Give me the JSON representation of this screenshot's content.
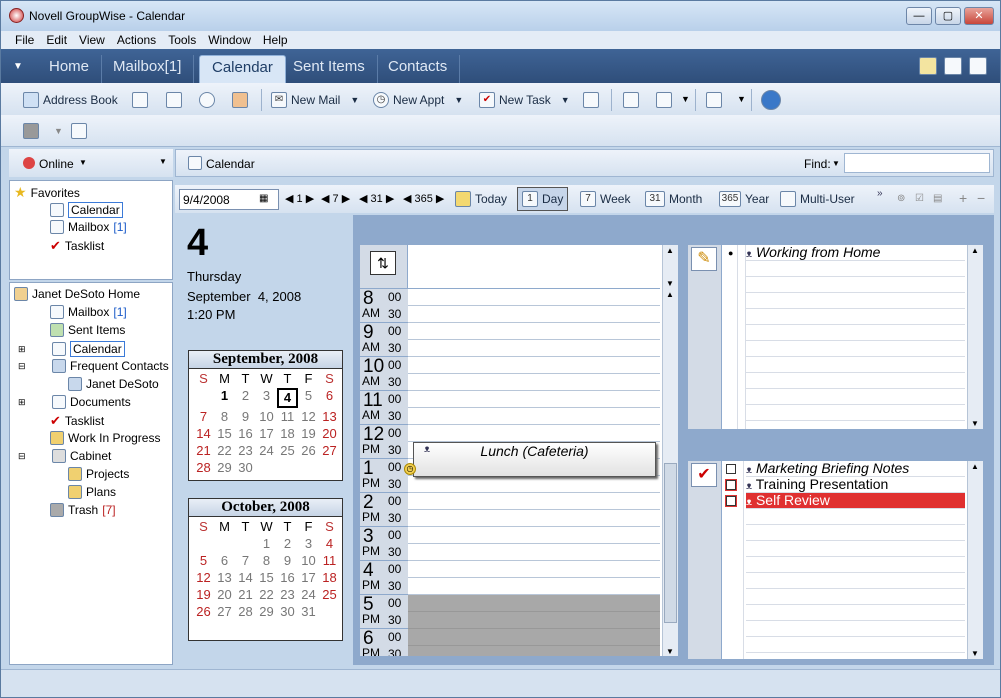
{
  "window": {
    "title": "Novell GroupWise - Calendar",
    "min": "—",
    "max": "▢",
    "close": "✕"
  },
  "menu": [
    "File",
    "Edit",
    "View",
    "Actions",
    "Tools",
    "Window",
    "Help"
  ],
  "tabs": [
    "Home",
    "Mailbox[1]",
    "Calendar",
    "Sent Items",
    "Contacts"
  ],
  "toolbar": {
    "address_book": "Address Book",
    "new_mail": "New Mail",
    "new_appt": "New Appt",
    "new_task": "New Task"
  },
  "left": {
    "online": "Online",
    "favorites": {
      "label": "Favorites",
      "calendar": "Calendar",
      "mailbox": "Mailbox",
      "mailbox_count": "[1]",
      "tasklist": "Tasklist"
    },
    "home": {
      "label": "Janet DeSoto Home",
      "mailbox": "Mailbox",
      "mailbox_count": "[1]",
      "sent": "Sent Items",
      "calendar": "Calendar",
      "frequent": "Frequent Contacts",
      "janet": "Janet DeSoto",
      "documents": "Documents",
      "tasklist": "Tasklist",
      "wip": "Work In Progress",
      "cabinet": "Cabinet",
      "projects": "Projects",
      "plans": "Plans",
      "trash": "Trash",
      "trash_count": "[7]"
    }
  },
  "calendar": {
    "header": "Calendar",
    "find_label": "Find:",
    "date_input": "9/4/2008",
    "jump": [
      "1",
      "7",
      "31",
      "365"
    ],
    "views": [
      "Today",
      "Day",
      "Week",
      "Month",
      "Year",
      "Multi-User"
    ]
  },
  "date": {
    "day": "4",
    "weekday": "Thursday",
    "full": "September  4, 2008",
    "time": "1:20 PM"
  },
  "minical": [
    {
      "title": "September, 2008",
      "weekdays": [
        "S",
        "M",
        "T",
        "W",
        "T",
        "F",
        "S"
      ]
    },
    {
      "title": "October, 2008",
      "weekdays": [
        "S",
        "M",
        "T",
        "W",
        "T",
        "F",
        "S"
      ]
    }
  ],
  "hours": [
    {
      "h": "8",
      "ap": "AM"
    },
    {
      "h": "9",
      "ap": "AM"
    },
    {
      "h": "10",
      "ap": "AM"
    },
    {
      "h": "11",
      "ap": "AM"
    },
    {
      "h": "12",
      "ap": "PM"
    },
    {
      "h": "1",
      "ap": "PM"
    },
    {
      "h": "2",
      "ap": "PM"
    },
    {
      "h": "3",
      "ap": "PM"
    },
    {
      "h": "4",
      "ap": "PM"
    },
    {
      "h": "5",
      "ap": "PM"
    },
    {
      "h": "6",
      "ap": "PM"
    }
  ],
  "minutes": [
    "00",
    "30"
  ],
  "appointment": {
    "title": "Lunch (Cafeteria)"
  },
  "reminders": {
    "item": "Working from Home"
  },
  "tasks": [
    {
      "title": "Marketing Briefing Notes",
      "italic": true
    },
    {
      "title": "Training Presentation",
      "italic": false
    },
    {
      "title": "Self Review",
      "italic": false,
      "highlight": true
    }
  ],
  "colors": {
    "accent": "#3b6294",
    "highlight": "#e03030"
  }
}
